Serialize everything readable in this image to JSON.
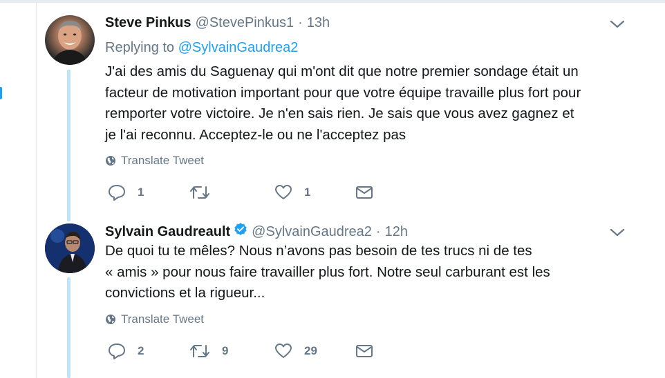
{
  "tweets": [
    {
      "author": "Steve Pinkus",
      "handle": "@StevePinkus1",
      "separator": "·",
      "time": "13h",
      "verified": false,
      "reply_prefix": "Replying to",
      "reply_mention": "@SylvainGaudrea2",
      "lines": [
        "J'ai des amis du Saguenay qui m'ont dit que notre premier sondage était un",
        "facteur de motivation important pour que votre équipe travaille plus fort pour",
        "remporter votre victoire. Je n'en sais rien. Je sais que vous avez gagnez et",
        "je l'ai reconnu. Acceptez-le ou ne l'acceptez pas"
      ],
      "translate_label": "Translate Tweet",
      "replies": "1",
      "retweets": "",
      "likes": "1"
    },
    {
      "author": "Sylvain Gaudreault",
      "handle": "@SylvainGaudrea2",
      "separator": "·",
      "time": "12h",
      "verified": true,
      "lines": [
        "De quoi tu te mêles? Nous n’avons pas besoin de tes trucs ni de tes",
        "« amis » pour nous faire travailler plus fort. Notre seul carburant est les",
        "convictions et la rigueur..."
      ],
      "translate_label": "Translate Tweet",
      "replies": "2",
      "retweets": "9",
      "likes": "29"
    }
  ],
  "icons": {
    "reply": "reply-icon",
    "retweet": "retweet-icon",
    "like": "heart-icon",
    "dm": "envelope-icon",
    "translate": "globe-icon",
    "menu": "chevron-down-icon",
    "verified": "verified-badge-icon"
  },
  "colors": {
    "accent": "#1da1f2",
    "muted": "#657786",
    "text": "#14171a",
    "thread": "#c1e3fa"
  }
}
